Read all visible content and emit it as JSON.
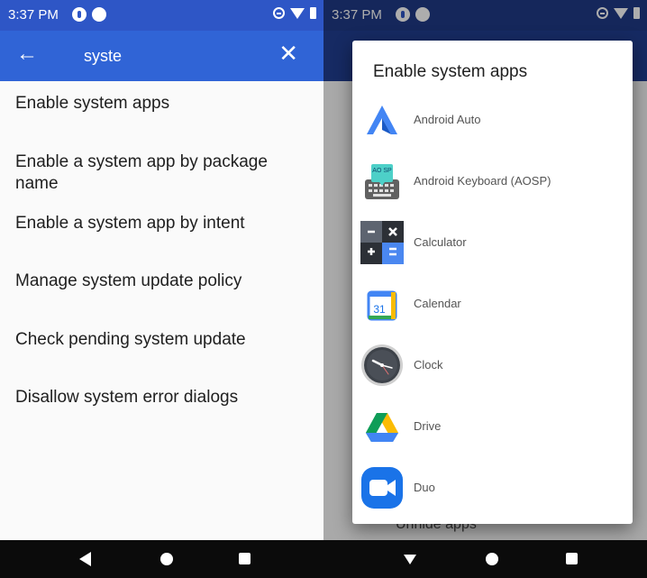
{
  "left": {
    "status": {
      "time": "3:37 PM"
    },
    "appbar": {
      "query": "syste",
      "back_icon": "←",
      "clear_icon": "✕"
    },
    "results": [
      "Enable system apps",
      "Enable a system app by package name",
      "Enable a system app by intent",
      "Manage system update policy",
      "Check pending system update",
      "Disallow system error dialogs"
    ]
  },
  "right": {
    "status": {
      "time": "3:37 PM"
    },
    "dialog": {
      "title": "Enable system apps",
      "apps": [
        "Android Auto",
        "Android Keyboard (AOSP)",
        "Calculator",
        "Calendar",
        "Clock",
        "Drive",
        "Duo"
      ]
    },
    "behind_text": "Unhide apps",
    "calendar_icon_text": "31",
    "keyboard_icon_text": "AO SP"
  },
  "colors": {
    "status_bar": "#2e56c6",
    "app_bar": "#3064d6",
    "nav_bar": "#0b0b0b"
  }
}
